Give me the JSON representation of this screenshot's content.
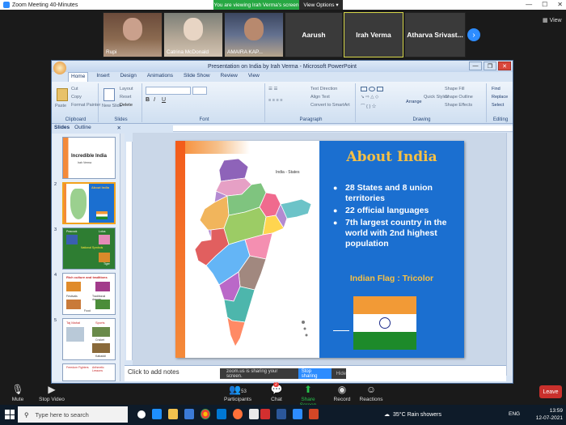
{
  "zoom": {
    "window_title": "Zoom Meeting 40-Minutes",
    "viewing_banner": "You are viewing Irah Verma's screen",
    "view_options": "View Options",
    "view_label": "View",
    "participants_tiles": [
      {
        "name": "Rupi"
      },
      {
        "name": "Catrina McDonald"
      },
      {
        "name": "AMAIRA KAP..."
      },
      {
        "name": "Aarush"
      },
      {
        "name": "Irah Verma"
      },
      {
        "name": "Atharva  Srivast..."
      }
    ],
    "share_bar": {
      "message": "zoom.us is sharing your screen.",
      "stop_label": "Stop sharing",
      "hide_label": "Hide"
    },
    "controls": [
      {
        "label": "Mute",
        "icon": "microphone-icon"
      },
      {
        "label": "Stop Video",
        "icon": "video-camera-icon"
      },
      {
        "label": "Participants",
        "icon": "participants-icon",
        "count": "53"
      },
      {
        "label": "Chat",
        "icon": "chat-icon",
        "badge": "2"
      },
      {
        "label": "Share Screen",
        "icon": "share-screen-icon"
      },
      {
        "label": "Record",
        "icon": "record-icon"
      },
      {
        "label": "Reactions",
        "icon": "reactions-icon"
      }
    ],
    "leave_label": "Leave"
  },
  "ppt": {
    "title": "Presentation on India by Irah Verma - Microsoft PowerPoint",
    "tabs": [
      "Home",
      "Insert",
      "Design",
      "Animations",
      "Slide Show",
      "Review",
      "View"
    ],
    "groups": {
      "clipboard": "Clipboard",
      "slides": "Slides",
      "font": "Font",
      "paragraph": "Paragraph",
      "drawing": "Drawing",
      "editing": "Editing"
    },
    "clipboard_items": [
      "Cut",
      "Copy",
      "Format Painter"
    ],
    "paste_label": "Paste",
    "slides_items": [
      "Layout",
      "Reset",
      "Delete"
    ],
    "new_slide_label": "New Slide",
    "paragraph_items": [
      "Text Direction",
      "Align Text",
      "Convert to SmartArt"
    ],
    "drawing_items": [
      "Shape Fill",
      "Shape Outline",
      "Shape Effects"
    ],
    "arrange_label": "Arrange",
    "quick_styles_label": "Quick Styles",
    "editing_items": [
      "Find",
      "Replace",
      "Select"
    ],
    "panel_tabs": [
      "Slides",
      "Outline"
    ],
    "thumbnails": [
      {
        "num": "",
        "title": "Incredible India",
        "sub": "Irah Verma"
      },
      {
        "num": "2",
        "title": "About India"
      },
      {
        "num": "3",
        "title": "",
        "labels": [
          "Peacock",
          "Lotus",
          "National Symbols",
          "Tiger"
        ]
      },
      {
        "num": "4",
        "title": "Rich culture and traditions",
        "labels": [
          "Festivals",
          "Traditional dances",
          "Food"
        ]
      },
      {
        "num": "5",
        "title": "",
        "labels": [
          "Taj Mahal",
          "Sports",
          "Cricket",
          "Kabaddi"
        ]
      },
      {
        "num": "",
        "labels": [
          "Freedom Fighters",
          "Arthmetic Lessons"
        ]
      }
    ],
    "notes_placeholder": "Click to add notes"
  },
  "slide": {
    "heading": "About India",
    "map_title": "India - States",
    "bullets": [
      "28 States and 8 union territories",
      "22 official languages",
      "7th largest country in the world with 2nd  highest population"
    ],
    "flag_label": "Indian Flag : Tricolor",
    "colors": {
      "panel_blue": "#1b6fd0",
      "heading_gold": "#f6c044",
      "saffron": "#f29a36",
      "green": "#1d8a2a"
    }
  },
  "taskbar": {
    "search_placeholder": "Type here to search",
    "weather": "35°C  Rain showers",
    "language": "ENG",
    "time": "13:59",
    "date": "12-07-2021"
  }
}
